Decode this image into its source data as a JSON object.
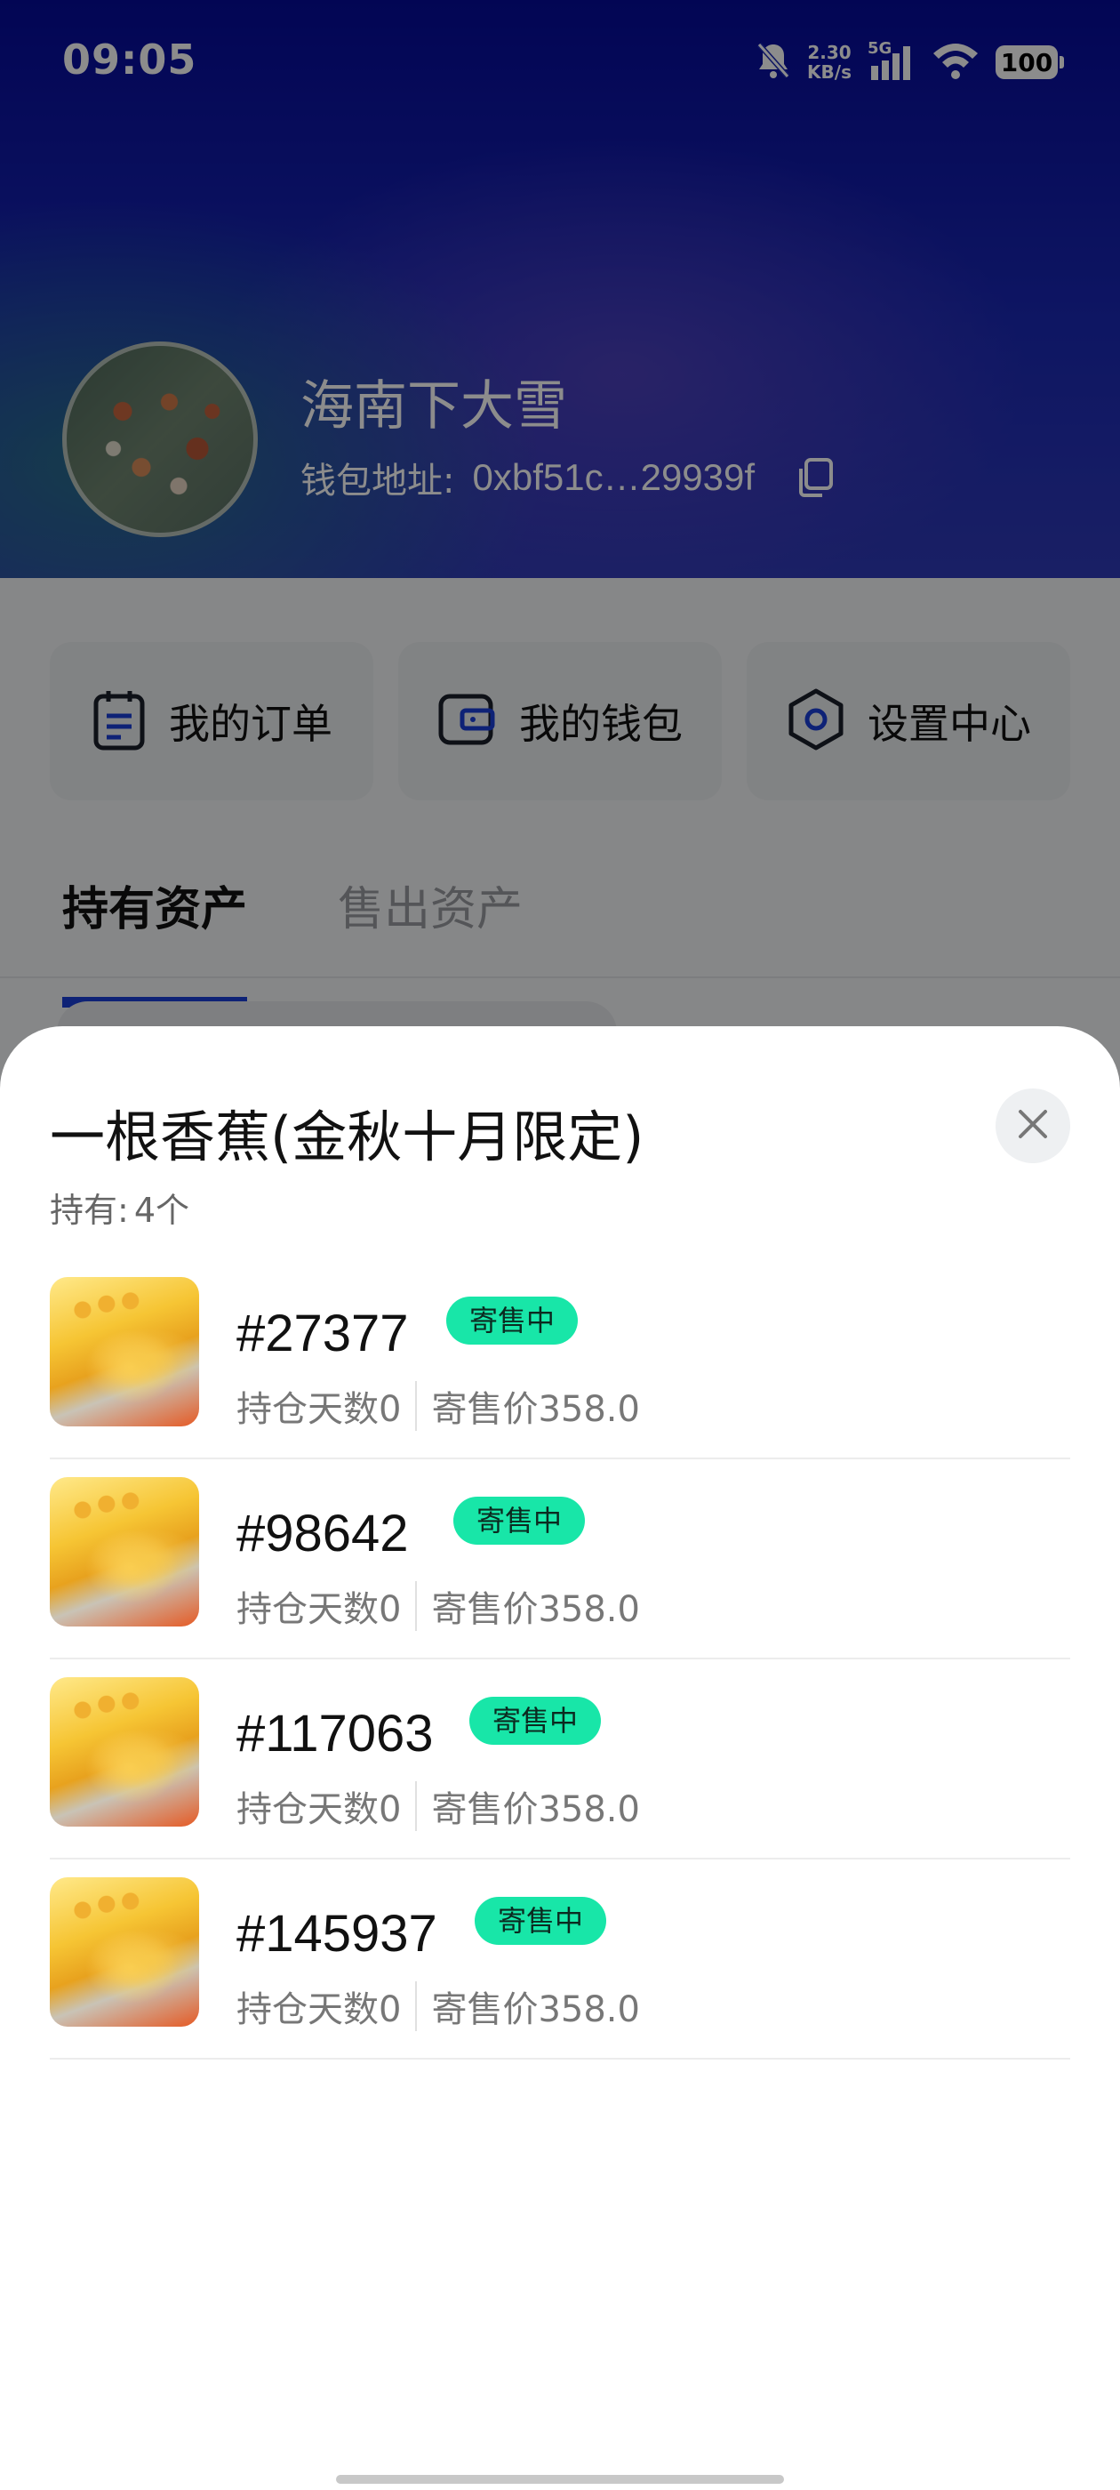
{
  "status_bar": {
    "time": "09:05",
    "net_speed_value": "2.30",
    "net_speed_unit": "KB/s",
    "signal_label": "5G",
    "battery": "100",
    "icons": [
      "bell-muted-icon",
      "signal-icon",
      "wifi-icon",
      "battery-icon"
    ]
  },
  "profile": {
    "name": "海南下大雪",
    "wallet_label": "钱包地址:",
    "wallet_address": "0xbf51c…29939f"
  },
  "quick_actions": [
    {
      "label": "我的订单",
      "icon": "order-icon"
    },
    {
      "label": "我的钱包",
      "icon": "wallet-icon"
    },
    {
      "label": "设置中心",
      "icon": "settings-icon"
    }
  ],
  "tabs": [
    {
      "label": "持有资产",
      "active": true
    },
    {
      "label": "售出资产",
      "active": false
    }
  ],
  "sheet": {
    "title": "一根香蕉(金秋十月限定)",
    "holdings_label": "持有:",
    "holdings_count": "4个",
    "items": [
      {
        "id": "#27377",
        "status": "寄售中",
        "days": "持仓天数0",
        "price": "寄售价358.0"
      },
      {
        "id": "#98642",
        "status": "寄售中",
        "days": "持仓天数0",
        "price": "寄售价358.0"
      },
      {
        "id": "#117063",
        "status": "寄售中",
        "days": "持仓天数0",
        "price": "寄售价358.0"
      },
      {
        "id": "#145937",
        "status": "寄售中",
        "days": "持仓天数0",
        "price": "寄售价358.0"
      }
    ]
  },
  "colors": {
    "accent": "#1a3ed8",
    "badge": "#18e6a8",
    "header_dark": "#050a9a"
  }
}
